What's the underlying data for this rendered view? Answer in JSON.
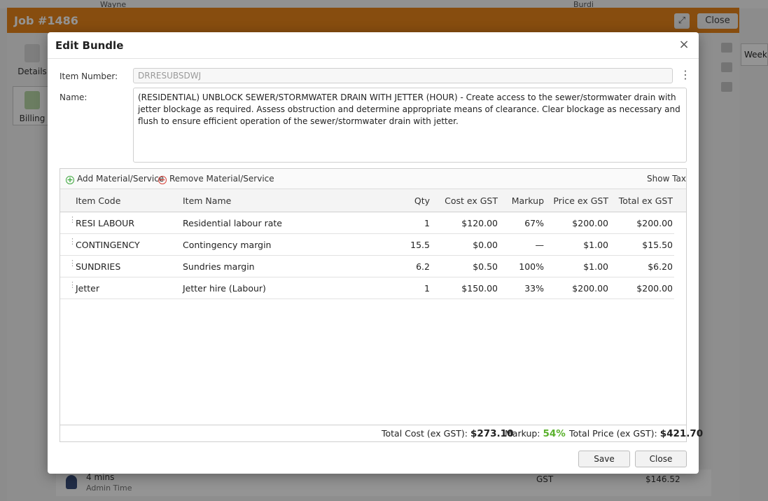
{
  "background": {
    "top_strip": [
      "Wayne",
      "Burdi"
    ],
    "job_title": "Job #1486",
    "job_close_label": "Close",
    "side_tabs": [
      "Details",
      "Billing"
    ],
    "week_label": "Week",
    "footer_row": {
      "duration": "4 mins",
      "type": "Admin Time",
      "tax": "GST",
      "amount": "$146.52"
    }
  },
  "modal": {
    "title": "Edit Bundle",
    "item_number_label": "Item Number:",
    "item_number_value": "DRRESUBSDWJ",
    "name_label": "Name:",
    "name_value": "(RESIDENTIAL) UNBLOCK SEWER/STORMWATER DRAIN WITH JETTER (HOUR) - Create access to the sewer/stormwater drain with jetter blockage as required. Assess obstruction and determine appropriate means of clearance. Clear blockage as necessary and flush to ensure efficient operation of the sewer/stormwater drain with jetter.",
    "toolbar": {
      "add_label": "Add Material/Service",
      "remove_label": "Remove Material/Service",
      "show_tax_label": "Show Tax"
    },
    "columns": {
      "code": "Item Code",
      "name": "Item Name",
      "qty": "Qty",
      "cost": "Cost ex GST",
      "markup": "Markup",
      "price": "Price ex GST",
      "total": "Total ex GST"
    },
    "rows": [
      {
        "code": "RESI LABOUR",
        "name": "Residential labour rate",
        "qty": "1",
        "cost": "$120.00",
        "markup": "67%",
        "price": "$200.00",
        "total": "$200.00"
      },
      {
        "code": "CONTINGENCY",
        "name": "Contingency margin",
        "qty": "15.5",
        "cost": "$0.00",
        "markup": "—",
        "price": "$1.00",
        "total": "$15.50"
      },
      {
        "code": "SUNDRIES",
        "name": "Sundries margin",
        "qty": "6.2",
        "cost": "$0.50",
        "markup": "100%",
        "price": "$1.00",
        "total": "$6.20"
      },
      {
        "code": "Jetter",
        "name": "Jetter hire (Labour)",
        "qty": "1",
        "cost": "$150.00",
        "markup": "33%",
        "price": "$200.00",
        "total": "$200.00"
      }
    ],
    "totals": {
      "total_cost_label": "Total Cost (ex GST):",
      "total_cost_value": "$273.10",
      "markup_label": "Markup:",
      "markup_value": "54%",
      "total_price_label": "Total Price (ex GST):",
      "total_price_value": "$421.70"
    },
    "save_label": "Save",
    "close_label": "Close"
  },
  "colors": {
    "job_header": "#e8861a",
    "markup_green": "#5ab12c",
    "add_green": "#3ea83e",
    "remove_red": "#d9443b"
  }
}
